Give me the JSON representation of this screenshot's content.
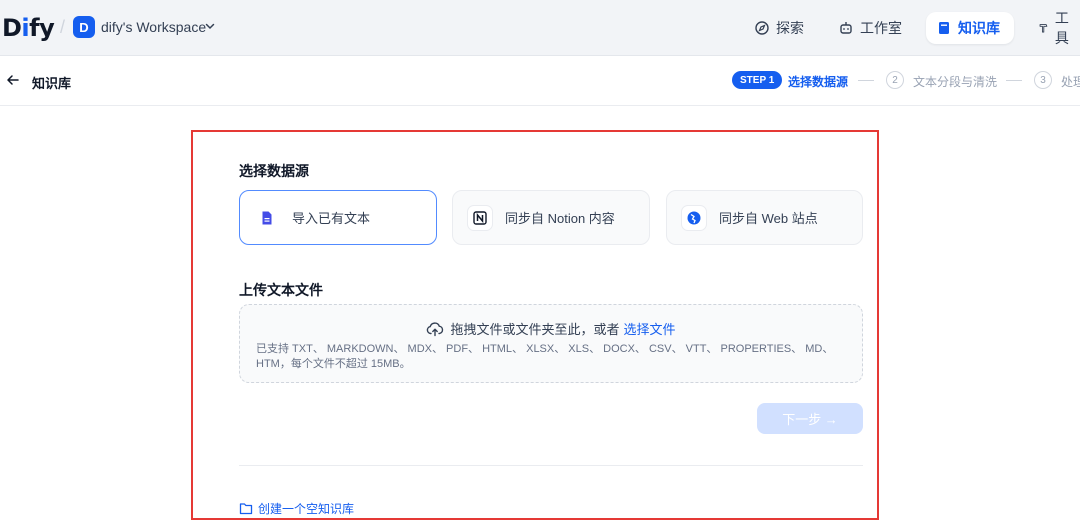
{
  "header": {
    "logo_prefix": "D",
    "logo_i": "i",
    "logo_suffix": "fy",
    "workspace_initial": "D",
    "workspace_name": "dify's Workspace",
    "nav": {
      "explore": "探索",
      "studio": "工作室",
      "knowledge": "知识库",
      "tools": "工具"
    }
  },
  "subbar": {
    "back_label": "知识库",
    "steps": [
      {
        "badge": "STEP 1",
        "label": "选择数据源"
      },
      {
        "badge": "2",
        "label": "文本分段与清洗"
      },
      {
        "badge": "3",
        "label": "处理并完成"
      }
    ]
  },
  "main": {
    "source_title": "选择数据源",
    "sources": [
      {
        "label": "导入已有文本"
      },
      {
        "label": "同步自 Notion 内容"
      },
      {
        "label": "同步自 Web 站点"
      }
    ],
    "upload_title": "上传文本文件",
    "dropzone": {
      "prompt": "拖拽文件或文件夹至此，或者",
      "link": "选择文件",
      "supported": "已支持 TXT、 MARKDOWN、 MDX、 PDF、 HTML、 XLSX、 XLS、 DOCX、 CSV、 VTT、 PROPERTIES、 MD、 HTM，每个文件不超过 15MB。"
    },
    "next_label": "下一步 →",
    "empty_kb_label": "创建一个空知识库"
  },
  "colors": {
    "accent": "#155eef",
    "frame": "#e53935"
  }
}
